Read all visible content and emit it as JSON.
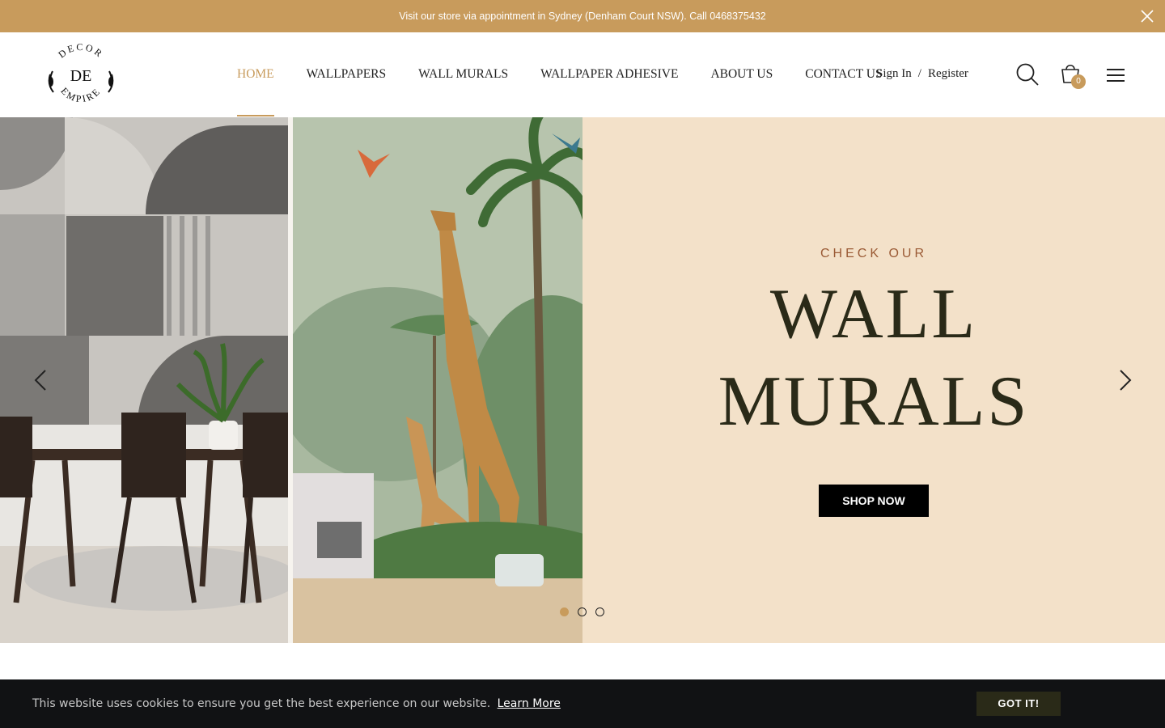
{
  "announcement": {
    "text": "Visit our store via appointment in Sydney (Denham Court NSW). Call 0468375432",
    "close_icon": "close-icon"
  },
  "header": {
    "logo": {
      "top_text": "DECOR",
      "monogram": "DE",
      "bottom_text": "EMPIRE"
    },
    "nav": [
      {
        "label": "HOME",
        "active": true
      },
      {
        "label": "WALLPAPERS",
        "active": false
      },
      {
        "label": "WALL MURALS",
        "active": false
      },
      {
        "label": "WALLPAPER ADHESIVE",
        "active": false
      },
      {
        "label": "ABOUT US",
        "active": false
      },
      {
        "label": "CONTACT US",
        "active": false
      }
    ],
    "account": {
      "sign_in": "Sign In",
      "separator": "/",
      "register": "Register"
    },
    "icons": {
      "search": "search-icon",
      "cart": "cart-icon",
      "menu": "hamburger-menu-icon"
    },
    "cart_count": "0"
  },
  "hero": {
    "kicker": "CHECK OUR",
    "title_line1": "WALL",
    "title_line2": "MURALS",
    "cta": "SHOP NOW",
    "slides_total": 3,
    "active_slide": 1,
    "images": [
      "geometric-wallpaper-dining-room",
      "jungle-giraffe-mural-kids-room"
    ]
  },
  "cookie": {
    "text": "This website uses cookies to ensure you get the best experience on our website.",
    "link": "Learn More",
    "button": "GOT IT!"
  },
  "colors": {
    "accent": "#c89b5c",
    "hero_bg": "#f3e1c9",
    "title": "#2a2a18",
    "kicker": "#9a5a35",
    "cookie_bg": "#111214"
  }
}
